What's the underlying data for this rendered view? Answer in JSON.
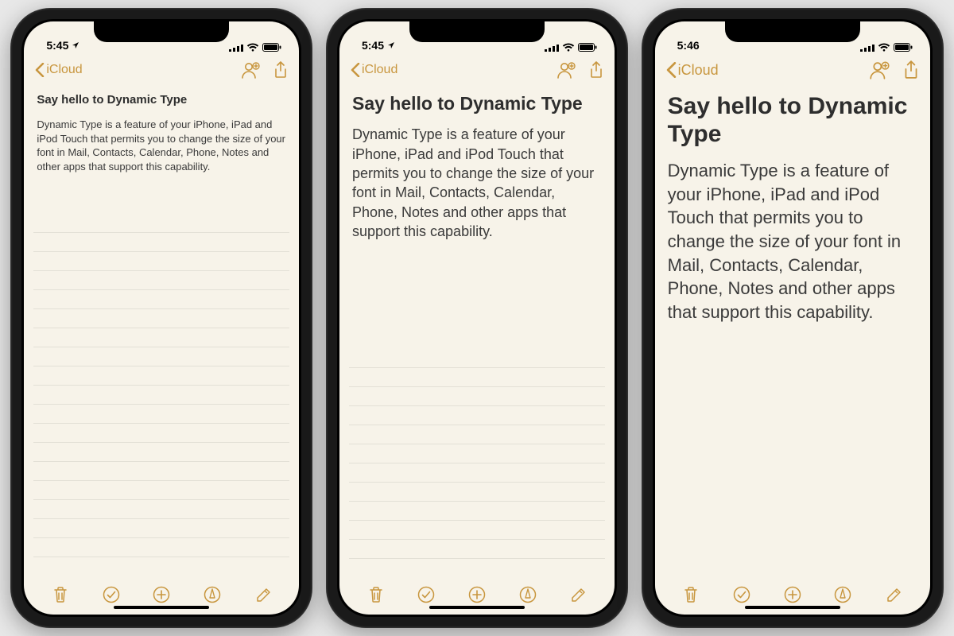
{
  "phones": [
    {
      "size_class": "size-s",
      "status": {
        "time": "5:45",
        "location_arrow": true
      },
      "nav": {
        "back_label": "iCloud"
      },
      "note": {
        "timestamp": "",
        "title": "Say hello to Dynamic Type",
        "body": "Dynamic Type is a feature of your iPhone, iPad and iPod Touch that permits you to change the size of your font in Mail, Contacts, Calendar, Phone, Notes and other apps that support this capability."
      },
      "rule_count": 20
    },
    {
      "size_class": "size-m",
      "status": {
        "time": "5:45",
        "location_arrow": true
      },
      "nav": {
        "back_label": "iCloud"
      },
      "note": {
        "timestamp": "",
        "title": "Say hello to Dynamic Type",
        "body": "Dynamic Type is a feature of your iPhone, iPad and iPod Touch that permits you to change the size of your font in Mail, Contacts, Calendar, Phone, Notes and other apps that support this capability."
      },
      "rule_count": 11
    },
    {
      "size_class": "size-l",
      "status": {
        "time": "5:46",
        "location_arrow": false
      },
      "nav": {
        "back_label": "iCloud"
      },
      "note": {
        "timestamp": "",
        "title": "Say hello to Dynamic Type",
        "body": "Dynamic Type is a feature of your iPhone, iPad and iPod Touch that permits you to change the size of your font in Mail, Contacts, Calendar, Phone, Notes and other apps that support this capability."
      },
      "rule_count": 0
    }
  ],
  "icons": {
    "back": "chevron-left-icon",
    "add_person": "add-person-icon",
    "share": "share-icon",
    "trash": "trash-icon",
    "check": "check-circle-icon",
    "plus": "plus-circle-icon",
    "draw": "draw-circle-icon",
    "compose": "compose-icon",
    "signal": "cellular-signal-icon",
    "wifi": "wifi-icon",
    "battery": "battery-icon",
    "location": "location-arrow-icon"
  },
  "colors": {
    "accent": "#c8963e",
    "paper": "#f7f3e9"
  }
}
